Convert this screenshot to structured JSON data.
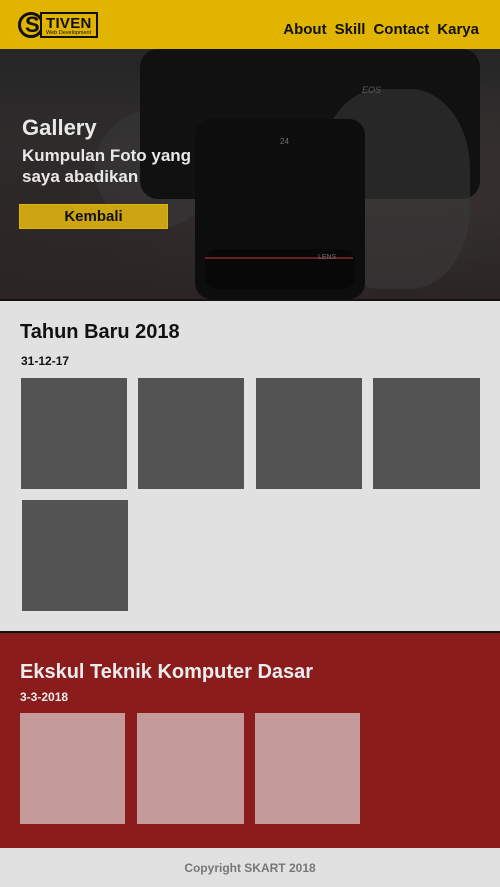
{
  "header": {
    "logo_letter": "S",
    "logo_title": "TIVEN",
    "logo_subtitle": "Web Development",
    "nav": [
      "About",
      "Skill",
      "Contact",
      "Karya"
    ]
  },
  "hero": {
    "title": "Gallery",
    "subtitle": "Kumpulan Foto yang saya abadikan",
    "button_label": "Kembali",
    "camera_text": [
      "EOS",
      "24",
      "LENS"
    ]
  },
  "albums": [
    {
      "title": "Tahun Baru 2018",
      "date": "31-12-17",
      "photo_count": 5
    },
    {
      "title": "Ekskul Teknik Komputer Dasar",
      "date": "3-3-2018",
      "photo_count": 3
    }
  ],
  "footer": {
    "text": "Copyright SKART 2018"
  },
  "colors": {
    "header_bg": "#e0b400",
    "button_bg": "#cda512",
    "album1_bg": "#e1e1e1",
    "album1_thumb": "#535353",
    "album2_bg": "#8a1c1c",
    "album2_thumb": "#c49a9a"
  }
}
